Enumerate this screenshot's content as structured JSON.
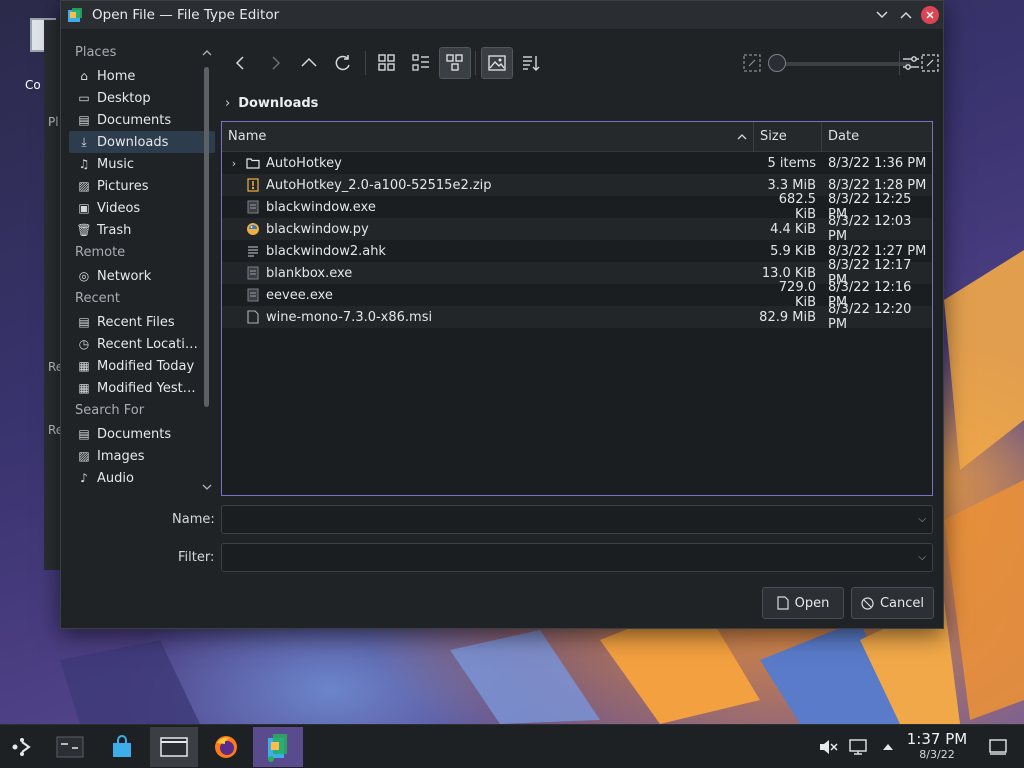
{
  "desktop": {
    "icon_label": "Co",
    "side_letters": [
      "Pl",
      "Re",
      "Re"
    ]
  },
  "dialog": {
    "title": "Open File — File Type Editor"
  },
  "sidebar": {
    "sections": [
      {
        "label": "Places",
        "items": [
          {
            "label": "Home",
            "icon": "home-icon"
          },
          {
            "label": "Desktop",
            "icon": "desktop-icon"
          },
          {
            "label": "Documents",
            "icon": "documents-icon"
          },
          {
            "label": "Downloads",
            "icon": "downloads-icon",
            "selected": true
          },
          {
            "label": "Music",
            "icon": "music-icon"
          },
          {
            "label": "Pictures",
            "icon": "pictures-icon"
          },
          {
            "label": "Videos",
            "icon": "videos-icon"
          },
          {
            "label": "Trash",
            "icon": "trash-icon"
          }
        ]
      },
      {
        "label": "Remote",
        "items": [
          {
            "label": "Network",
            "icon": "network-icon"
          }
        ]
      },
      {
        "label": "Recent",
        "items": [
          {
            "label": "Recent Files",
            "icon": "recent-files-icon"
          },
          {
            "label": "Recent Locati…",
            "icon": "recent-locations-icon"
          },
          {
            "label": "Modified Today",
            "icon": "calendar-icon"
          },
          {
            "label": "Modified Yest…",
            "icon": "calendar-icon"
          }
        ]
      },
      {
        "label": "Search For",
        "items": [
          {
            "label": "Documents",
            "icon": "documents-icon"
          },
          {
            "label": "Images",
            "icon": "images-icon"
          },
          {
            "label": "Audio",
            "icon": "audio-icon"
          }
        ]
      }
    ]
  },
  "breadcrumb": {
    "current": "Downloads"
  },
  "filelist": {
    "columns": {
      "name": "Name",
      "size": "Size",
      "date": "Date"
    },
    "rows": [
      {
        "name": "AutoHotkey",
        "size": "5 items",
        "date": "8/3/22 1:36 PM",
        "type": "folder"
      },
      {
        "name": "AutoHotkey_2.0-a100-52515e2.zip",
        "size": "3.3 MiB",
        "date": "8/3/22 1:28 PM",
        "type": "zip"
      },
      {
        "name": "blackwindow.exe",
        "size": "682.5 KiB",
        "date": "8/3/22 12:25 PM",
        "type": "exe"
      },
      {
        "name": "blackwindow.py",
        "size": "4.4 KiB",
        "date": "8/3/22 12:03 PM",
        "type": "python"
      },
      {
        "name": "blackwindow2.ahk",
        "size": "5.9 KiB",
        "date": "8/3/22 1:27 PM",
        "type": "text"
      },
      {
        "name": "blankbox.exe",
        "size": "13.0 KiB",
        "date": "8/3/22 12:17 PM",
        "type": "exe"
      },
      {
        "name": "eevee.exe",
        "size": "729.0 KiB",
        "date": "8/3/22 12:16 PM",
        "type": "exe"
      },
      {
        "name": "wine-mono-7.3.0-x86.msi",
        "size": "82.9 MiB",
        "date": "8/3/22 12:20 PM",
        "type": "file"
      }
    ]
  },
  "form": {
    "name_label": "Name:",
    "name_value": "",
    "filter_label": "Filter:",
    "filter_value": ""
  },
  "buttons": {
    "open": "Open",
    "cancel": "Cancel"
  },
  "taskbar": {
    "time": "1:37 PM",
    "date": "8/3/22"
  },
  "colors": {
    "accent": "#7c6fc7",
    "selection": "#2e3d4e",
    "close": "#da4453"
  }
}
